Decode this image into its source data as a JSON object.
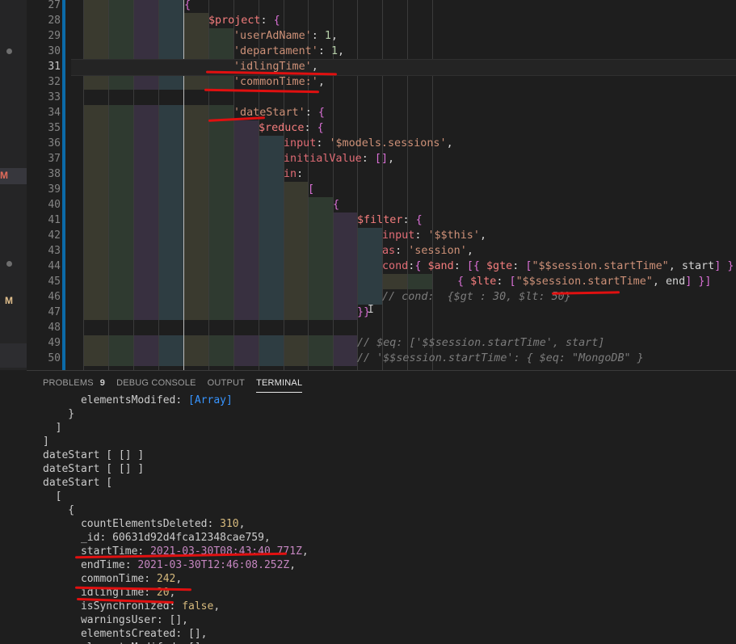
{
  "left_strip": {
    "m1": "M",
    "m2": "M"
  },
  "editor": {
    "active_line": "31",
    "lines": [
      {
        "n": "27",
        "text": "{"
      },
      {
        "n": "28",
        "text": "$project: {"
      },
      {
        "n": "29",
        "text": "'userAdName': 1,"
      },
      {
        "n": "30",
        "text": "'departament': 1,"
      },
      {
        "n": "31",
        "text": "'idlingTime',"
      },
      {
        "n": "32",
        "text": "'commonTime:',"
      },
      {
        "n": "33",
        "text": ""
      },
      {
        "n": "34",
        "text": "'dateStart': {"
      },
      {
        "n": "35",
        "text": "$reduce: {"
      },
      {
        "n": "36",
        "text": "input: '$models.sessions',"
      },
      {
        "n": "37",
        "text": "initialValue: [],"
      },
      {
        "n": "38",
        "text": "in:"
      },
      {
        "n": "39",
        "text": "["
      },
      {
        "n": "40",
        "text": "{"
      },
      {
        "n": "41",
        "text": "$filter: {"
      },
      {
        "n": "42",
        "text": "input: '$$this',"
      },
      {
        "n": "43",
        "text": "as: 'session',"
      },
      {
        "n": "44",
        "text": "cond:{ $and: [{ $gte: [\"$$session.startTime\", start] },"
      },
      {
        "n": "45",
        "text": "{ $lte: [\"$$session.startTime\", end] }]"
      },
      {
        "n": "46",
        "text": "// cond:  {$gt : 30, $lt: 50}"
      },
      {
        "n": "47",
        "text": "}}"
      },
      {
        "n": "48",
        "text": ""
      },
      {
        "n": "49",
        "text": "// $eq: ['$$session.startTime', start]"
      },
      {
        "n": "50",
        "text": "// '$$session.startTime': { $eq: \"MongoDB\" }"
      }
    ]
  },
  "panel": {
    "tabs": [
      {
        "label": "PROBLEMS",
        "badge": "9"
      },
      {
        "label": "DEBUG CONSOLE"
      },
      {
        "label": "OUTPUT"
      },
      {
        "label": "TERMINAL",
        "active": true
      }
    ],
    "terminal_lines": [
      "      elementsModifed: [Array]",
      "    }",
      "  ]",
      "]",
      "dateStart [ [] ]",
      "dateStart [ [] ]",
      "dateStart [",
      "  [",
      "    {",
      "      countElementsDeleted: 310,",
      "      _id: 60631d92d4fca12348cae759,",
      "      startTime: 2021-03-30T08:43:40.771Z,",
      "      endTime: 2021-03-30T12:46:08.252Z,",
      "      commonTime: 242,",
      "      idlingTime: 20,",
      "      isSynchronized: false,",
      "      warningsUser: [],",
      "      elementsCreated: [],",
      "      elementsModifed: []"
    ]
  },
  "colors": {
    "accent": "#0b6aa8",
    "underline": "#e01010",
    "tab_active": "#e7e7e7"
  }
}
